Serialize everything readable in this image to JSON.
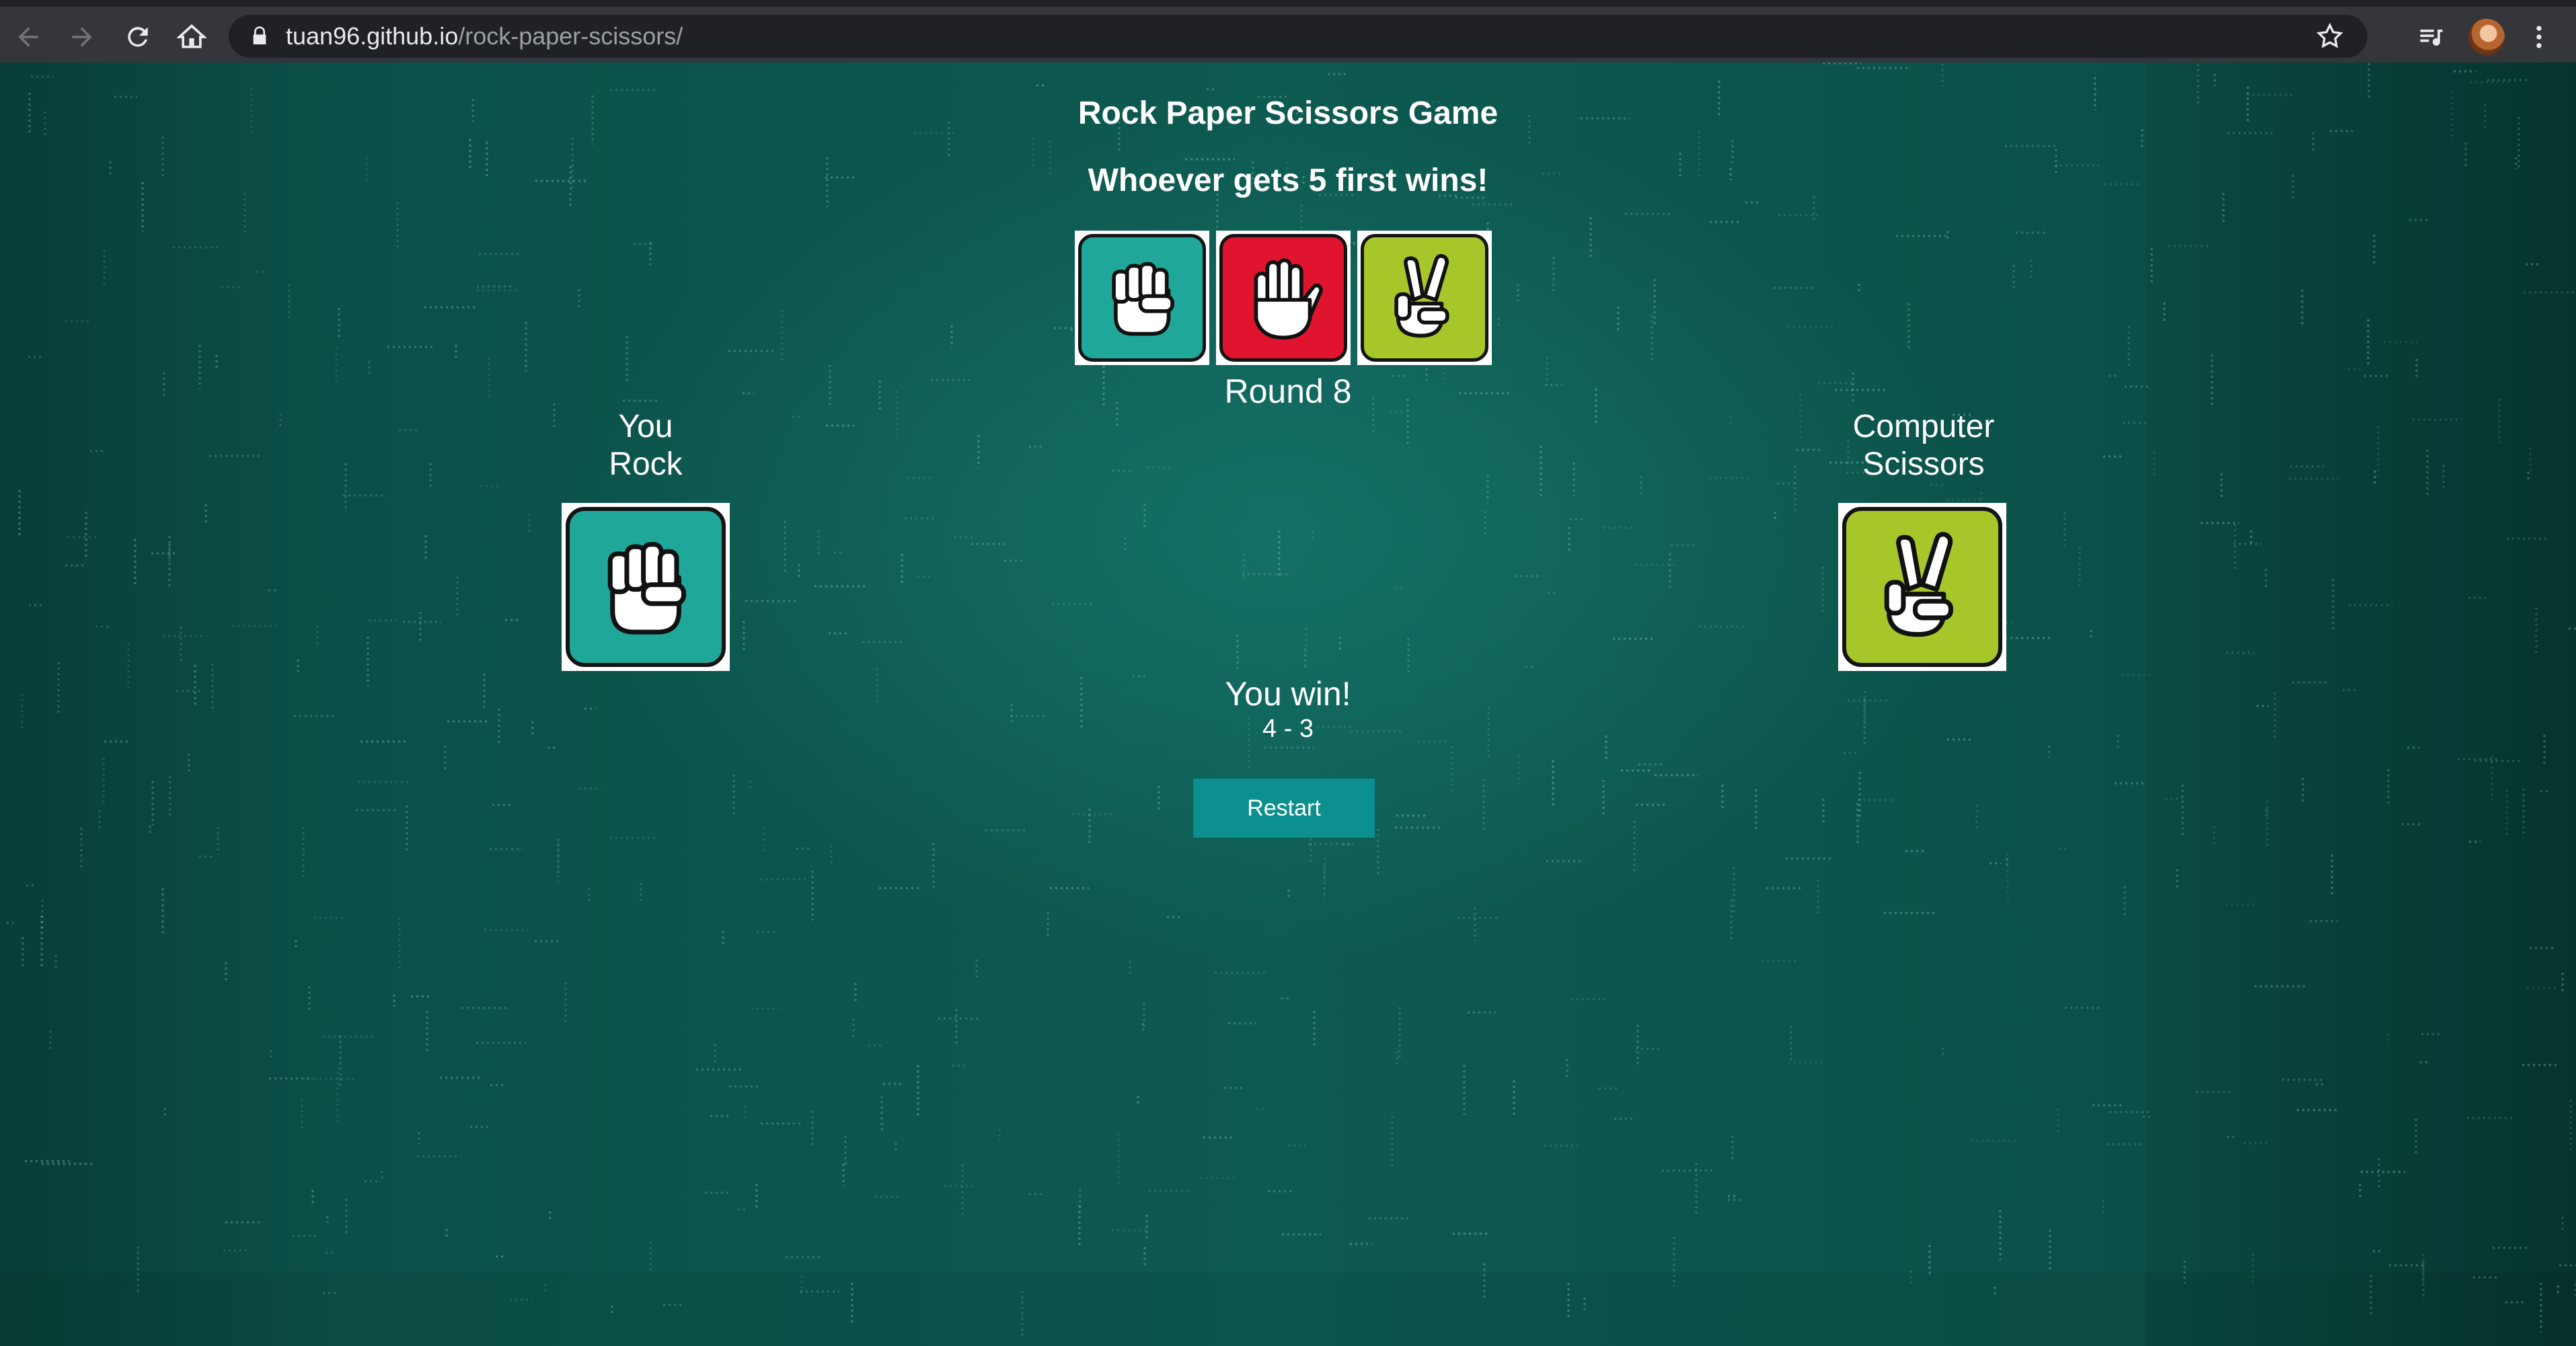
{
  "browser": {
    "url_domain": "tuan96.github.io",
    "url_path": "/rock-paper-scissors/"
  },
  "game": {
    "title": "Rock Paper Scissors Game",
    "subtitle": "Whoever gets 5 first wins!",
    "choices": [
      {
        "name": "rock",
        "color": "#1fa89a"
      },
      {
        "name": "paper",
        "color": "#e0142e"
      },
      {
        "name": "scissors",
        "color": "#a7c62a"
      }
    ],
    "round_label": "Round 8",
    "player": {
      "label": "You",
      "choice": "Rock"
    },
    "computer": {
      "label": "Computer",
      "choice": "Scissors"
    },
    "result": "You win!",
    "score": "4 - 3",
    "restart_label": "Restart"
  }
}
